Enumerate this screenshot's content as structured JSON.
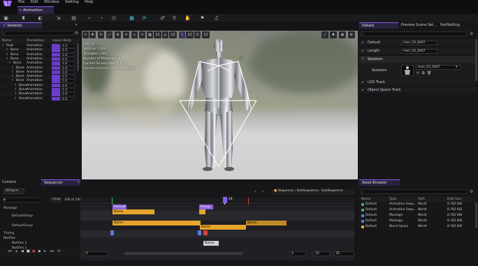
{
  "menu": [
    "File",
    "Edit",
    "Window",
    "Setting",
    "Help"
  ],
  "doc_tab": "Animation",
  "skeleton_panel": {
    "title": "Skeleton",
    "columns": [
      "Name",
      "Translation",
      "Upper Body"
    ],
    "rows": [
      {
        "name": "Root",
        "mode": "Animation",
        "value": "1.0"
      },
      {
        "name": "Bone",
        "mode": "Animation",
        "value": "1.0"
      },
      {
        "name": "Bone",
        "mode": "Animation",
        "value": "1.0"
      },
      {
        "name": "Bone",
        "mode": "Animation",
        "value": "1.0"
      },
      {
        "name": "Bone",
        "mode": "Animation",
        "value": "1.0"
      },
      {
        "name": "Bone",
        "mode": "Animation",
        "value": "1.0"
      },
      {
        "name": "Bone",
        "mode": "Animation",
        "value": "1.0"
      },
      {
        "name": "Bone",
        "mode": "Animation",
        "value": "1.0"
      },
      {
        "name": "Bone",
        "mode": "Animation",
        "value": "1.0"
      },
      {
        "name": "Bone",
        "mode": "Animation",
        "value": "1.0"
      },
      {
        "name": "Bone",
        "mode": "Animation",
        "value": "1.0"
      },
      {
        "name": "Bone",
        "mode": "Animation",
        "value": "1.0"
      },
      {
        "name": "Bone",
        "mode": "Animation",
        "value": "1.0"
      }
    ]
  },
  "viewport": {
    "stats": [
      "LOD: 0",
      "Vertices: 1300",
      "Triangles: 1300",
      "Number of Materials: 2",
      "Current Screen Size: 0.670",
      "Current Camera Distance: 83.00"
    ],
    "toolbar_values": [
      "12",
      "12",
      "12",
      "12",
      "12"
    ]
  },
  "details": {
    "tabs": [
      "Details",
      "Preview Scene Set...",
      "PartSetting"
    ],
    "default_label": "Default",
    "default_value": "man_03_0007",
    "length_label": "Length",
    "length_value": "man_03_0007",
    "skeleton_section": "Skeleton",
    "skeleton_label": "Skeleton",
    "skeleton_value": "man_03_0007",
    "lod_track": "LOD Track",
    "object_space_track": "Object Space Track"
  },
  "bottom_tabs": {
    "content": "Content",
    "sequencer": "Sequencer"
  },
  "sequencer": {
    "fps": "30 fps",
    "frame": "0100",
    "range": "100 of 100",
    "breadcrumb": [
      "Sequence",
      "SubSequence",
      "SubSequence"
    ],
    "playhead": "24",
    "tracks": [
      "Montage",
      "DefaultGroup",
      "DefaultGroup",
      "Timing",
      "Notifies",
      "Notifies 1",
      "Notifies 2"
    ],
    "clips": {
      "default": "Default",
      "name1": "Name",
      "name2": "Name",
      "name3": "Name",
      "name4": "Name",
      "name5": "Name",
      "group": "Group"
    },
    "bottom_values": [
      "0",
      "0",
      "10",
      "30"
    ]
  },
  "asset_browser": {
    "title": "Asset Browser",
    "columns": [
      "Name",
      "Type",
      "Path",
      "Disk Size"
    ],
    "rows": [
      {
        "name": "Default",
        "type": "Animation Sequ...",
        "path": "World",
        "size": "8.782 KiB"
      },
      {
        "name": "Default",
        "type": "Animation Sequ...",
        "path": "World",
        "size": "8.782 KiB"
      },
      {
        "name": "Default",
        "type": "Montage",
        "path": "World",
        "size": "8.782 KiB"
      },
      {
        "name": "Default",
        "type": "Montage",
        "path": "World",
        "size": "8.782 KiB"
      },
      {
        "name": "Default",
        "type": "Blend Space",
        "path": "World",
        "size": "8.782 KiB"
      }
    ]
  },
  "colors": {
    "accent": "#8a5cf5",
    "upper_body_bar": "#6b3ec9",
    "clip_orange": "#e6a42b",
    "clip_purple": "#8b63e0"
  }
}
